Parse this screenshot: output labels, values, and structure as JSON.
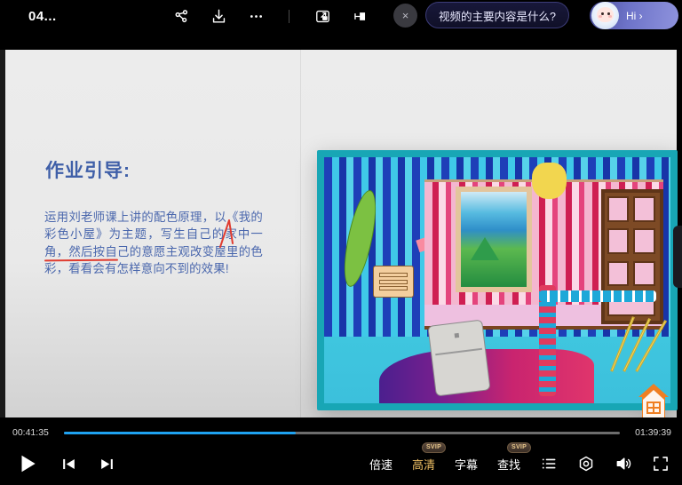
{
  "topbar": {
    "title": "04...",
    "icons": [
      {
        "name": "share-icon",
        "label": "分享"
      },
      {
        "name": "download-icon",
        "label": "下载"
      },
      {
        "name": "more-icon",
        "label": "更多"
      },
      {
        "name": "picture-in-picture-icon",
        "label": "画中画"
      },
      {
        "name": "cast-icon",
        "label": "投屏"
      }
    ],
    "close_label": "×",
    "question_bubble": "视频的主要内容是什么?",
    "avatar_greeting": "Hi ›"
  },
  "slide": {
    "heading": "作业引导:",
    "body": "运用刘老师课上讲的配色原理，以《我的彩色小屋》为主题，写生自己的家中一角，然后按自己的意愿主观改变屋里的色彩，看看会有怎样意向不到的效果!",
    "annotation_color": "#e03b2f",
    "heading_color": "#3f5fa8",
    "body_color": "#4a67ad",
    "artwork_alt": "彩色小屋学生绘画作品",
    "watermark": "house-icon"
  },
  "player": {
    "current_time": "00:41:35",
    "total_time": "01:39:39",
    "progress_percent": 41.7,
    "progress_color": "#1fa2f0",
    "track_color": "#6d6d6d",
    "buttons": {
      "play": "play-icon",
      "previous": "previous-icon",
      "next": "next-icon",
      "playlist": "playlist-icon",
      "eye_care": "eye-care-icon",
      "volume": "volume-icon",
      "fullscreen": "fullscreen-icon"
    },
    "text_buttons": [
      {
        "label": "倍速",
        "badge": null,
        "gold": false
      },
      {
        "label": "高清",
        "badge": "SVIP",
        "gold": true
      },
      {
        "label": "字幕",
        "badge": null,
        "gold": false
      },
      {
        "label": "查找",
        "badge": "SVIP",
        "gold": false
      }
    ]
  }
}
